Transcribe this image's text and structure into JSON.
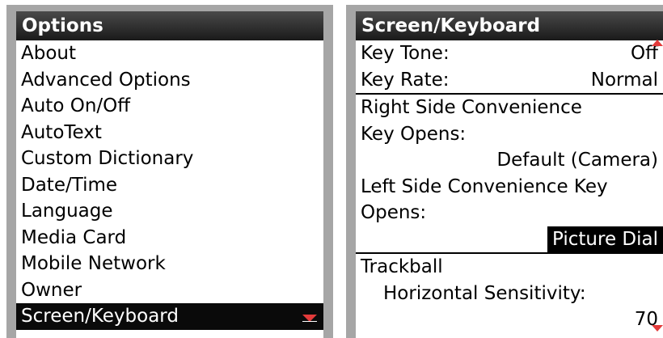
{
  "options_screen": {
    "title": "Options",
    "items": [
      {
        "label": "About"
      },
      {
        "label": "Advanced Options"
      },
      {
        "label": "Auto On/Off"
      },
      {
        "label": "AutoText"
      },
      {
        "label": "Custom Dictionary"
      },
      {
        "label": "Date/Time"
      },
      {
        "label": "Language"
      },
      {
        "label": "Media Card"
      },
      {
        "label": "Mobile Network"
      },
      {
        "label": "Owner"
      },
      {
        "label": "Screen/Keyboard"
      }
    ],
    "selected_index": 10
  },
  "keyboard_screen": {
    "title": "Screen/Keyboard",
    "key_tone_label": "Key Tone:",
    "key_tone_value": "Off",
    "key_rate_label": "Key Rate:",
    "key_rate_value": "Normal",
    "right_key_label_1": "Right Side Convenience",
    "right_key_label_2": "Key Opens:",
    "right_key_value": "Default (Camera)",
    "left_key_label_1": "Left Side Convenience Key",
    "left_key_label_2": "Opens:",
    "left_key_value": "Picture Dial",
    "trackball_label": "Trackball",
    "horizontal_label": "Horizontal Sensitivity:",
    "horizontal_value": "70"
  },
  "colors": {
    "scroll_arrow": "#e23a3a",
    "bezel": "#a6a6a6",
    "selection": "#0a0a0a"
  },
  "icons": [
    "scroll-down-icon",
    "scroll-up-icon"
  ]
}
